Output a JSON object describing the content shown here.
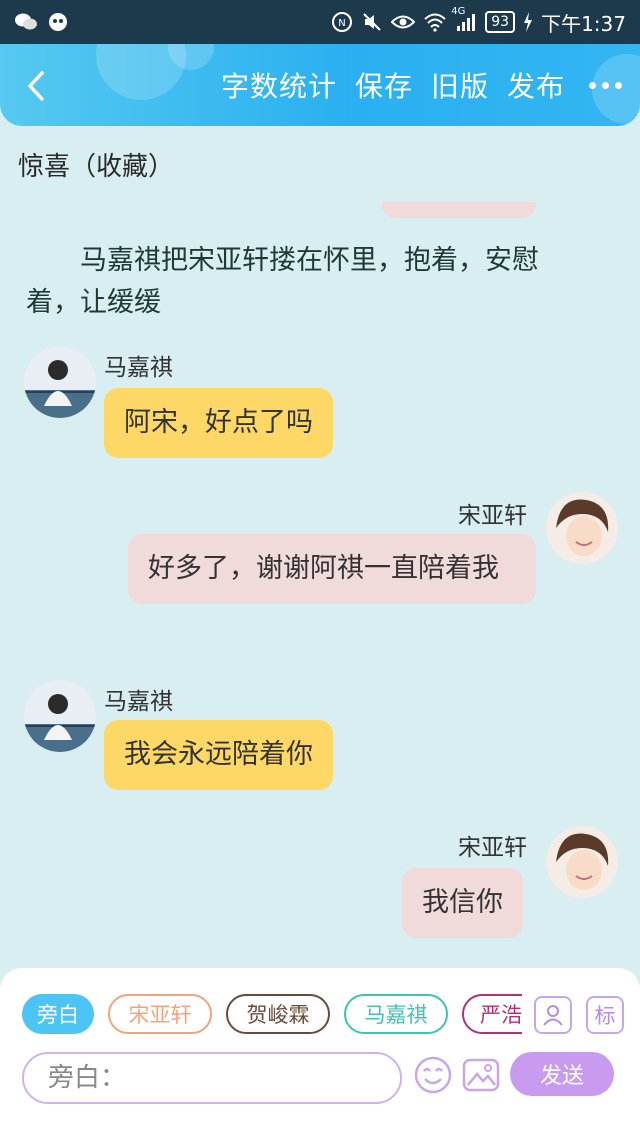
{
  "status_bar": {
    "signal_label": "4G",
    "battery": "93",
    "time": "下午1:37"
  },
  "header": {
    "actions": [
      "字数统计",
      "保存",
      "旧版",
      "发布"
    ],
    "back_icon": "chevron-left-icon",
    "more_icon": "more-dots-icon"
  },
  "story": {
    "title": "惊喜（收藏）",
    "narration": "马嘉祺把宋亚轩搂在怀里，抱着，安慰着，让缓缓"
  },
  "messages": [
    {
      "speaker": "马嘉祺",
      "text": "阿宋，好点了吗",
      "side": "left"
    },
    {
      "speaker": "宋亚轩",
      "text": "好多了，谢谢阿祺一直陪着我",
      "side": "right"
    },
    {
      "speaker": "马嘉祺",
      "text": "我会永远陪着你",
      "side": "left"
    },
    {
      "speaker": "宋亚轩",
      "text": "我信你",
      "side": "right"
    }
  ],
  "composer": {
    "characters": [
      {
        "label": "旁白",
        "color": "#4cc4f4",
        "selected": true
      },
      {
        "label": "宋亚轩",
        "color": "#f3a37a",
        "selected": false
      },
      {
        "label": "贺峻霖",
        "color": "#6b4a3a",
        "selected": false
      },
      {
        "label": "马嘉祺",
        "color": "#3fc2b4",
        "selected": false
      },
      {
        "label": "严浩",
        "color": "#b0307a",
        "selected": false
      }
    ],
    "tag_button": "标",
    "input_placeholder": "旁白：",
    "send_label": "发送"
  },
  "colors": {
    "background": "#d8eef0",
    "header": "#2ab0f0",
    "left_bubble": "#fdd866",
    "right_bubble": "#f0dada",
    "send_button": "#c89bf0"
  }
}
